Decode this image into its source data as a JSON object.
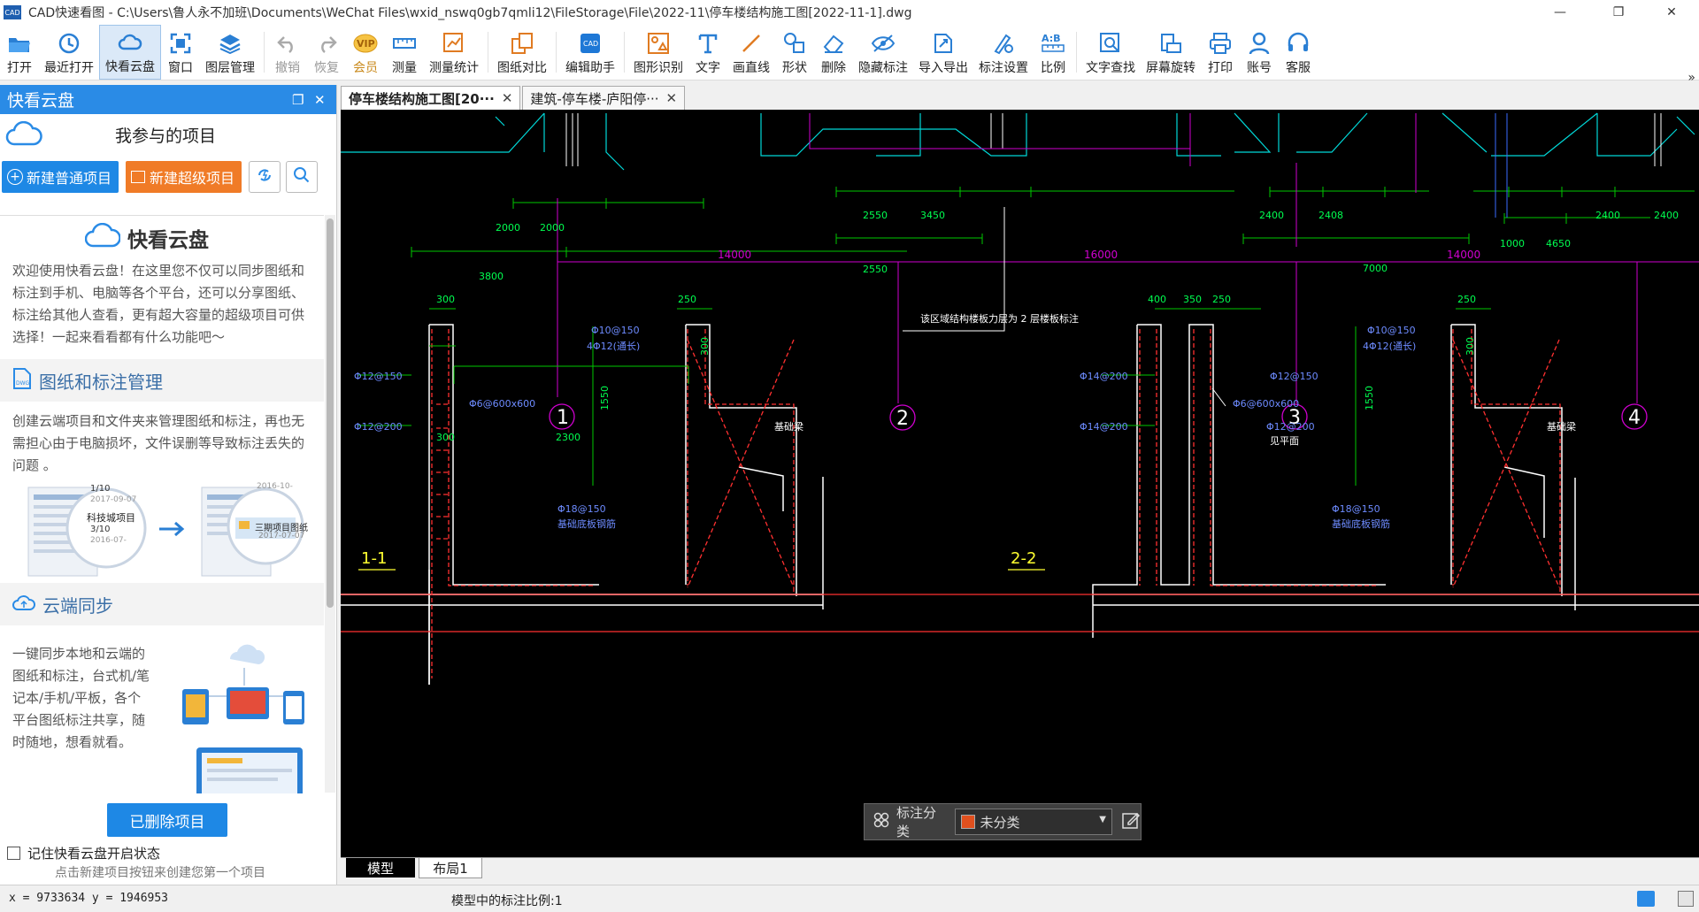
{
  "window": {
    "title": "CAD快速看图 - C:\\Users\\鲁人永不加班\\Documents\\WeChat Files\\wxid_nswq0gb7qmli12\\FileStorage\\File\\2022-11\\停车楼结构施工图[2022-11-1].dwg",
    "app_icon_text": "CAD"
  },
  "toolbar": {
    "items": [
      {
        "label": "打开",
        "icon": "folder-open-icon"
      },
      {
        "label": "最近打开",
        "icon": "recent-clock-icon"
      },
      {
        "label": "快看云盘",
        "icon": "cloud-icon"
      },
      {
        "label": "窗口",
        "icon": "window-fit-icon"
      },
      {
        "label": "图层管理",
        "icon": "layers-icon"
      },
      {
        "label": "撤销",
        "icon": "undo-icon"
      },
      {
        "label": "恢复",
        "icon": "redo-icon"
      },
      {
        "label": "会员",
        "icon": "vip-badge-icon"
      },
      {
        "label": "测量",
        "icon": "ruler-icon"
      },
      {
        "label": "测量统计",
        "icon": "measure-stats-icon"
      },
      {
        "label": "图纸对比",
        "icon": "compare-icon"
      },
      {
        "label": "编辑助手",
        "icon": "edit-assistant-icon"
      },
      {
        "label": "图形识别",
        "icon": "shape-recognize-icon"
      },
      {
        "label": "文字",
        "icon": "text-tool-icon"
      },
      {
        "label": "画直线",
        "icon": "line-tool-icon"
      },
      {
        "label": "形状",
        "icon": "shapes-icon"
      },
      {
        "label": "删除",
        "icon": "eraser-icon"
      },
      {
        "label": "隐藏标注",
        "icon": "hide-eye-icon"
      },
      {
        "label": "导入导出",
        "icon": "import-export-icon"
      },
      {
        "label": "标注设置",
        "icon": "annotation-settings-icon"
      },
      {
        "label": "比例",
        "icon": "scale-ab-icon"
      },
      {
        "label": "文字查找",
        "icon": "text-search-icon"
      },
      {
        "label": "屏幕旋转",
        "icon": "rotate-screen-icon"
      },
      {
        "label": "打印",
        "icon": "printer-icon"
      },
      {
        "label": "账号",
        "icon": "user-icon"
      },
      {
        "label": "客服",
        "icon": "headset-icon"
      }
    ],
    "more": "»"
  },
  "left_panel": {
    "header": "快看云盘",
    "my_projects": "我参与的项目",
    "new_normal": "新建普通项目",
    "new_super": "新建超级项目",
    "intro_title": "快看云盘",
    "intro_text": "欢迎使用快看云盘！在这里您不仅可以同步图纸和标注到手机、电脑等各个平台，还可以分享图纸、标注给其他人查看，更有超大容量的超级项目可供选择！一起来看看都有什么功能吧～",
    "sec1_title": "图纸和标注管理",
    "sec1_text": "创建云端项目和文件夹来管理图纸和标注，再也无需担心由于电脑损坏，文件误删等导致标注丢失的问题 。",
    "sec1_thumb_a": [
      "科技城项目",
      "3/10",
      "2016-07-",
      "1/10",
      "2017-09-07"
    ],
    "sec1_thumb_b": [
      "三期项目图纸",
      "2017-07-07",
      "2016-10-"
    ],
    "sec2_title": "云端同步",
    "sec2_text": "一键同步本地和云端的图纸和标注，台式机/笔记本/手机/平板，各个平台图纸标注共享，随时随地，想看就看。",
    "deleted": "已删除项目",
    "remember": "记住快看云盘开启状态",
    "hint": "点击新建项目按钮来创建您第一个项目"
  },
  "tabs": [
    {
      "label": "停车楼结构施工图[20···",
      "active": true
    },
    {
      "label": "建筑-停车楼-庐阳停···",
      "active": false
    }
  ],
  "drawing": {
    "section_labels": [
      "1-1",
      "2-2"
    ],
    "axis_numbers": [
      "1",
      "2",
      "3",
      "4"
    ],
    "dims_top": [
      "2000",
      "2000",
      "3800",
      "2550",
      "3450",
      "2550",
      "2400",
      "2408",
      "7000",
      "1000",
      "4650",
      "2400",
      "2400"
    ],
    "dims_mag": [
      "14000",
      "16000",
      "14000"
    ],
    "dims_wall": [
      "300",
      "250",
      "400",
      "350",
      "250",
      "250",
      "300",
      "2300",
      "1550",
      "1550",
      "300",
      "300"
    ],
    "rebar_left": [
      "Φ10@150",
      "4Φ12(通长)",
      "Φ6@600x600",
      "Φ12@150",
      "Φ12@200",
      "Φ18@150",
      "基础底板钢筋"
    ],
    "rebar_right": [
      "Φ10@150",
      "4Φ12(通长)",
      "Φ6@600x600",
      "Φ12@150",
      "Φ12@200",
      "Φ14@200",
      "Φ14@200",
      "Φ18@150",
      "基础底板钢筋"
    ],
    "misc": [
      "基础梁",
      "基础梁",
      "见平面",
      "该区域结构楼板力层为 2 层楼板标注"
    ]
  },
  "annotation_bar": {
    "label": "标注分类",
    "value": "未分类",
    "swatch": "#e0501e"
  },
  "layout_tabs": [
    "模型",
    "布局1"
  ],
  "status": {
    "coords": "x = 9733634  y = 1946953",
    "scale_text": "模型中的标注比例:1"
  },
  "colors": {
    "accent": "#2a8be6",
    "orange": "#f07b27",
    "canvas": "#000000"
  }
}
